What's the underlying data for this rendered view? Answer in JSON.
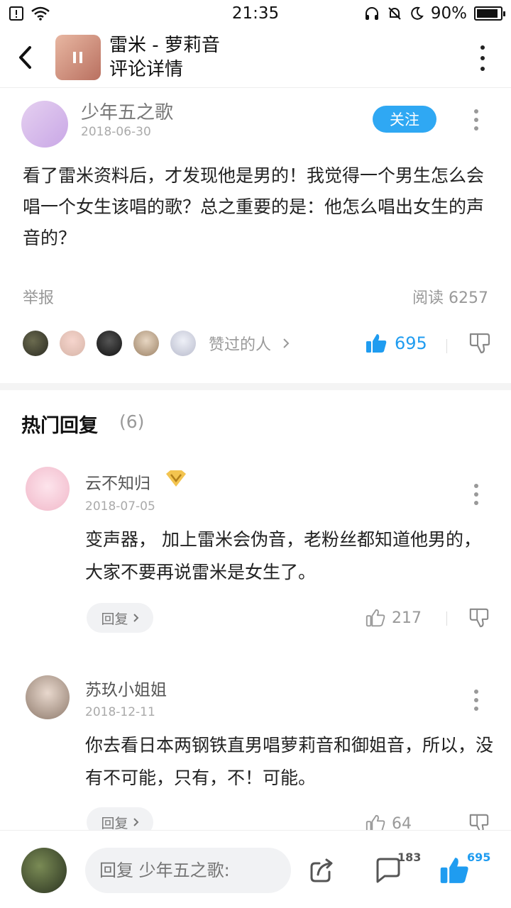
{
  "status": {
    "time": "21:35",
    "battery": "90%",
    "battery_level": 0.9
  },
  "header": {
    "title": "雷米 - 萝莉音",
    "subtitle": "评论详情"
  },
  "comment": {
    "author": "少年五之歌",
    "date": "2018-06-30",
    "follow_label": "关注",
    "text": "看了雷米资料后，才发现他是男的！我觉得一个男生怎么会唱一个女生该唱的歌？总之重要的是：他怎么唱出女生的声音的？",
    "report_label": "举报",
    "read_count": "阅读 6257",
    "likers_label": "赞过的人",
    "like_count": "695"
  },
  "hot": {
    "title": "热门回复",
    "count": "(6)"
  },
  "replies": [
    {
      "name": "云不知归",
      "date": "2018-07-05",
      "text": "变声器， 加上雷米会伪音，老粉丝都知道他男的，大家不要再说雷米是女生了。",
      "reply_label": "回复",
      "likes": "217"
    },
    {
      "name": "苏玖小姐姐",
      "date": "2018-12-11",
      "text": "你去看日本两钢铁直男唱萝莉音和御姐音，所以，没有不可能，只有，不！可能。",
      "reply_label": "回复",
      "likes": "64"
    }
  ],
  "bottom": {
    "input_placeholder": "回复 少年五之歌:",
    "comment_count": "183",
    "like_count": "695"
  },
  "colors": {
    "accent": "#1f9cf0",
    "follow_bg": "#2fa8f3"
  }
}
